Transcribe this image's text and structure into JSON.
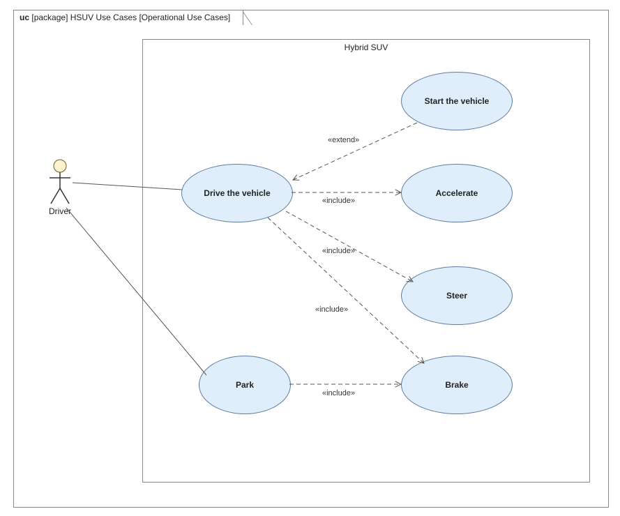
{
  "frame": {
    "kind": "uc",
    "scope": "[package]",
    "title": "HSUV Use Cases",
    "subtitle": "[Operational Use Cases]"
  },
  "subject": {
    "name": "Hybrid SUV"
  },
  "actor": {
    "name": "Driver"
  },
  "usecases": {
    "drive": "Drive the vehicle",
    "start": "Start the vehicle",
    "accel": "Accelerate",
    "steer": "Steer",
    "brake": "Brake",
    "park": "Park"
  },
  "relationships": {
    "extend": "«extend»",
    "include": "«include»"
  },
  "chart_data": {
    "type": "table",
    "diagram_type": "SysML/UML Use Case Diagram",
    "frame": "uc [package] HSUV Use Cases [Operational Use Cases]",
    "subject": "Hybrid SUV",
    "actors": [
      "Driver"
    ],
    "use_cases": [
      "Drive the vehicle",
      "Park",
      "Start the vehicle",
      "Accelerate",
      "Steer",
      "Brake"
    ],
    "edges": [
      {
        "from": "Driver",
        "to": "Drive the vehicle",
        "type": "association"
      },
      {
        "from": "Driver",
        "to": "Park",
        "type": "association"
      },
      {
        "from": "Start the vehicle",
        "to": "Drive the vehicle",
        "type": "extend"
      },
      {
        "from": "Drive the vehicle",
        "to": "Accelerate",
        "type": "include"
      },
      {
        "from": "Drive the vehicle",
        "to": "Steer",
        "type": "include"
      },
      {
        "from": "Drive the vehicle",
        "to": "Brake",
        "type": "include"
      },
      {
        "from": "Park",
        "to": "Brake",
        "type": "include"
      }
    ]
  }
}
